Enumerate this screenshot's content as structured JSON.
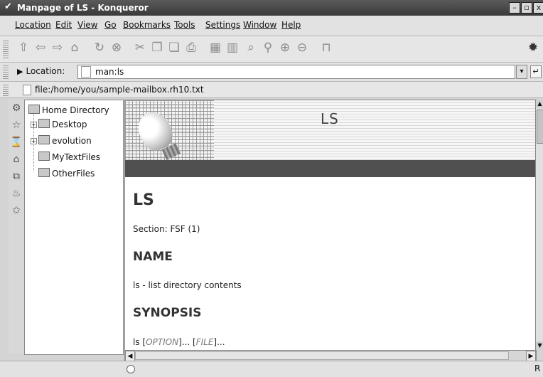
{
  "window": {
    "title": "Manpage of LS - Konqueror",
    "controls": [
      "–",
      "▫",
      "x"
    ]
  },
  "menubar": {
    "items": [
      "Location",
      "Edit",
      "View",
      "Go",
      "Bookmarks",
      "Tools",
      "Settings",
      "Window",
      "Help"
    ]
  },
  "toolbar": {
    "icons": [
      "up-icon",
      "back-icon",
      "forward-icon",
      "home-icon",
      "reload-icon",
      "stop-icon",
      "cut-icon",
      "copy-icon",
      "paste-icon",
      "print-icon",
      "icon-view-icon",
      "list-view-icon",
      "find-icon",
      "zoom-icon",
      "zoom-in-icon",
      "zoom-out-icon",
      "lock-icon"
    ],
    "glyphs": [
      "⇧",
      "⇦",
      "⇨",
      "⌂",
      "↻",
      "⊗",
      "✂",
      "❐",
      "❏",
      "⎙",
      "▦",
      "▥",
      "⌕",
      "⚲",
      "⊕",
      "⊖",
      "⊓"
    ]
  },
  "location": {
    "label": "Location:",
    "value": "man:ls"
  },
  "path": {
    "value": "file:/home/you/sample-mailbox.rh10.txt"
  },
  "tree": {
    "root": "Home Directory",
    "items": [
      "Desktop",
      "evolution",
      "MyTextFiles",
      "OtherFiles"
    ]
  },
  "document": {
    "banner_title": "LS",
    "heading": "LS",
    "section": "Section: FSF (1)",
    "name_heading": "NAME",
    "name_text": "ls - list directory contents",
    "synopsis_heading": "SYNOPSIS",
    "synopsis_cmd": "ls [",
    "synopsis_opt": "OPTION",
    "synopsis_mid": "]... [",
    "synopsis_file": "FILE",
    "synopsis_end": "]..."
  },
  "status": {
    "right": "R"
  }
}
